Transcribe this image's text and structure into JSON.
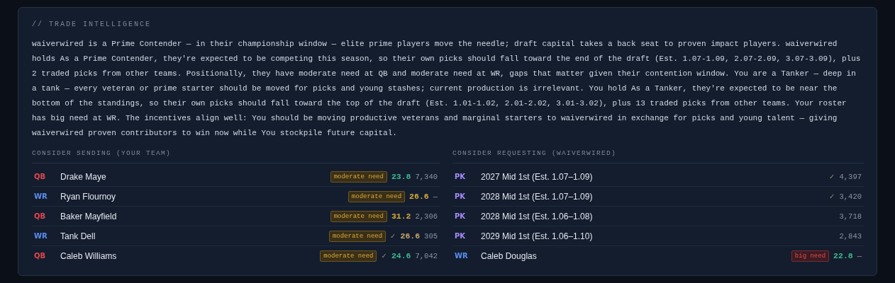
{
  "heading": "// TRADE INTELLIGENCE",
  "summary": "waiverwired is a Prime Contender — in their championship window — elite prime players move the needle; draft capital takes a back seat to proven impact players. waiverwired holds As a Prime Contender, they're expected to be competing this season, so their own picks should fall toward the end of the draft (Est. 1.07-1.09, 2.07-2.09, 3.07-3.09), plus 2 traded picks from other teams. Positionally, they have moderate need at QB and moderate need at WR, gaps that matter given their contention window. You are a Tanker — deep in a tank — every veteran or prime starter should be moved for picks and young stashes; current production is irrelevant. You hold As a Tanker, they're expected to be near the bottom of the standings, so their own picks should fall toward the top of the draft (Est. 1.01-1.02, 2.01-2.02, 3.01-3.02), plus 13 traded picks from other teams. Your roster has big need at WR. The incentives align well: You should be moving productive veterans and marginal starters to waiverwired in exchange for picks and young talent — giving waiverwired proven contributors to win now while You stockpile future capital.",
  "columns": [
    {
      "title": "CONSIDER SENDING (YOUR TEAM)",
      "rows": [
        {
          "pos": {
            "text": "QB",
            "color": "#e5484d"
          },
          "name": "Drake Maye",
          "need": {
            "text": "moderate need",
            "kind": "moderate"
          },
          "age": {
            "text": "23.8",
            "color": "#3fb68b"
          },
          "value": "7,340"
        },
        {
          "pos": {
            "text": "WR",
            "color": "#5b8def"
          },
          "name": "Ryan Flournoy",
          "need": {
            "text": "moderate need",
            "kind": "moderate"
          },
          "age": {
            "text": "26.6",
            "color": "#d9a93a"
          },
          "value": "—"
        },
        {
          "pos": {
            "text": "QB",
            "color": "#e5484d"
          },
          "name": "Baker Mayfield",
          "need": {
            "text": "moderate need",
            "kind": "moderate"
          },
          "age": {
            "text": "31.2",
            "color": "#d9a93a"
          },
          "value": "2,306"
        },
        {
          "pos": {
            "text": "WR",
            "color": "#5b8def"
          },
          "name": "Tank Dell",
          "need": {
            "text": "moderate need",
            "kind": "moderate"
          },
          "check": "✓",
          "age": {
            "text": "26.6",
            "color": "#c8a66a"
          },
          "value": "305"
        },
        {
          "pos": {
            "text": "QB",
            "color": "#e5484d"
          },
          "name": "Caleb Williams",
          "need": {
            "text": "moderate need",
            "kind": "moderate"
          },
          "check": "✓",
          "age": {
            "text": "24.6",
            "color": "#3fb68b"
          },
          "value": "7,042"
        }
      ]
    },
    {
      "title": "CONSIDER REQUESTING (WAIVERWIRED)",
      "rows": [
        {
          "pos": {
            "text": "PK",
            "color": "#a78bfa"
          },
          "name": "2027 Mid 1st (Est. 1.07–1.09)",
          "check": "✓",
          "value": "4,397"
        },
        {
          "pos": {
            "text": "PK",
            "color": "#a78bfa"
          },
          "name": "2028 Mid 1st (Est. 1.07–1.09)",
          "check": "✓",
          "value": "3,420"
        },
        {
          "pos": {
            "text": "PK",
            "color": "#a78bfa"
          },
          "name": "2028 Mid 1st (Est. 1.06–1.08)",
          "value": "3,718"
        },
        {
          "pos": {
            "text": "PK",
            "color": "#a78bfa"
          },
          "name": "2029 Mid 1st (Est. 1.06–1.10)",
          "value": "2,843"
        },
        {
          "pos": {
            "text": "WR",
            "color": "#5b8def"
          },
          "name": "Caleb Douglas",
          "need": {
            "text": "big need",
            "kind": "big"
          },
          "age": {
            "text": "22.8",
            "color": "#3fb68b"
          },
          "value": "—"
        }
      ]
    }
  ]
}
